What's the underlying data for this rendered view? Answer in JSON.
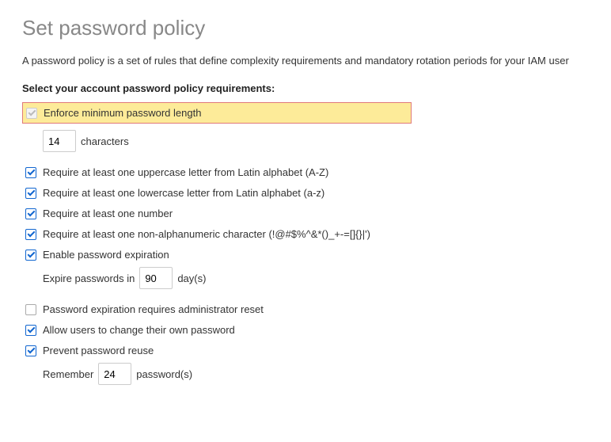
{
  "title": "Set password policy",
  "description": "A password policy is a set of rules that define complexity requirements and mandatory rotation periods for your IAM user",
  "sectionLabel": "Select your account password policy requirements:",
  "options": {
    "minLength": {
      "label": "Enforce minimum password length",
      "value": "14",
      "suffix": "characters"
    },
    "uppercase": {
      "label": "Require at least one uppercase letter from Latin alphabet (A-Z)"
    },
    "lowercase": {
      "label": "Require at least one lowercase letter from Latin alphabet (a-z)"
    },
    "number": {
      "label": "Require at least one number"
    },
    "nonAlpha": {
      "label": "Require at least one non-alphanumeric character (!@#$%^&*()_+-=[]{}|')"
    },
    "expiration": {
      "label": "Enable password expiration",
      "prefix": "Expire passwords in",
      "value": "90",
      "suffix": "day(s)"
    },
    "adminReset": {
      "label": "Password expiration requires administrator reset"
    },
    "allowChange": {
      "label": "Allow users to change their own password"
    },
    "preventReuse": {
      "label": "Prevent password reuse",
      "prefix": "Remember",
      "value": "24",
      "suffix": "password(s)"
    }
  }
}
